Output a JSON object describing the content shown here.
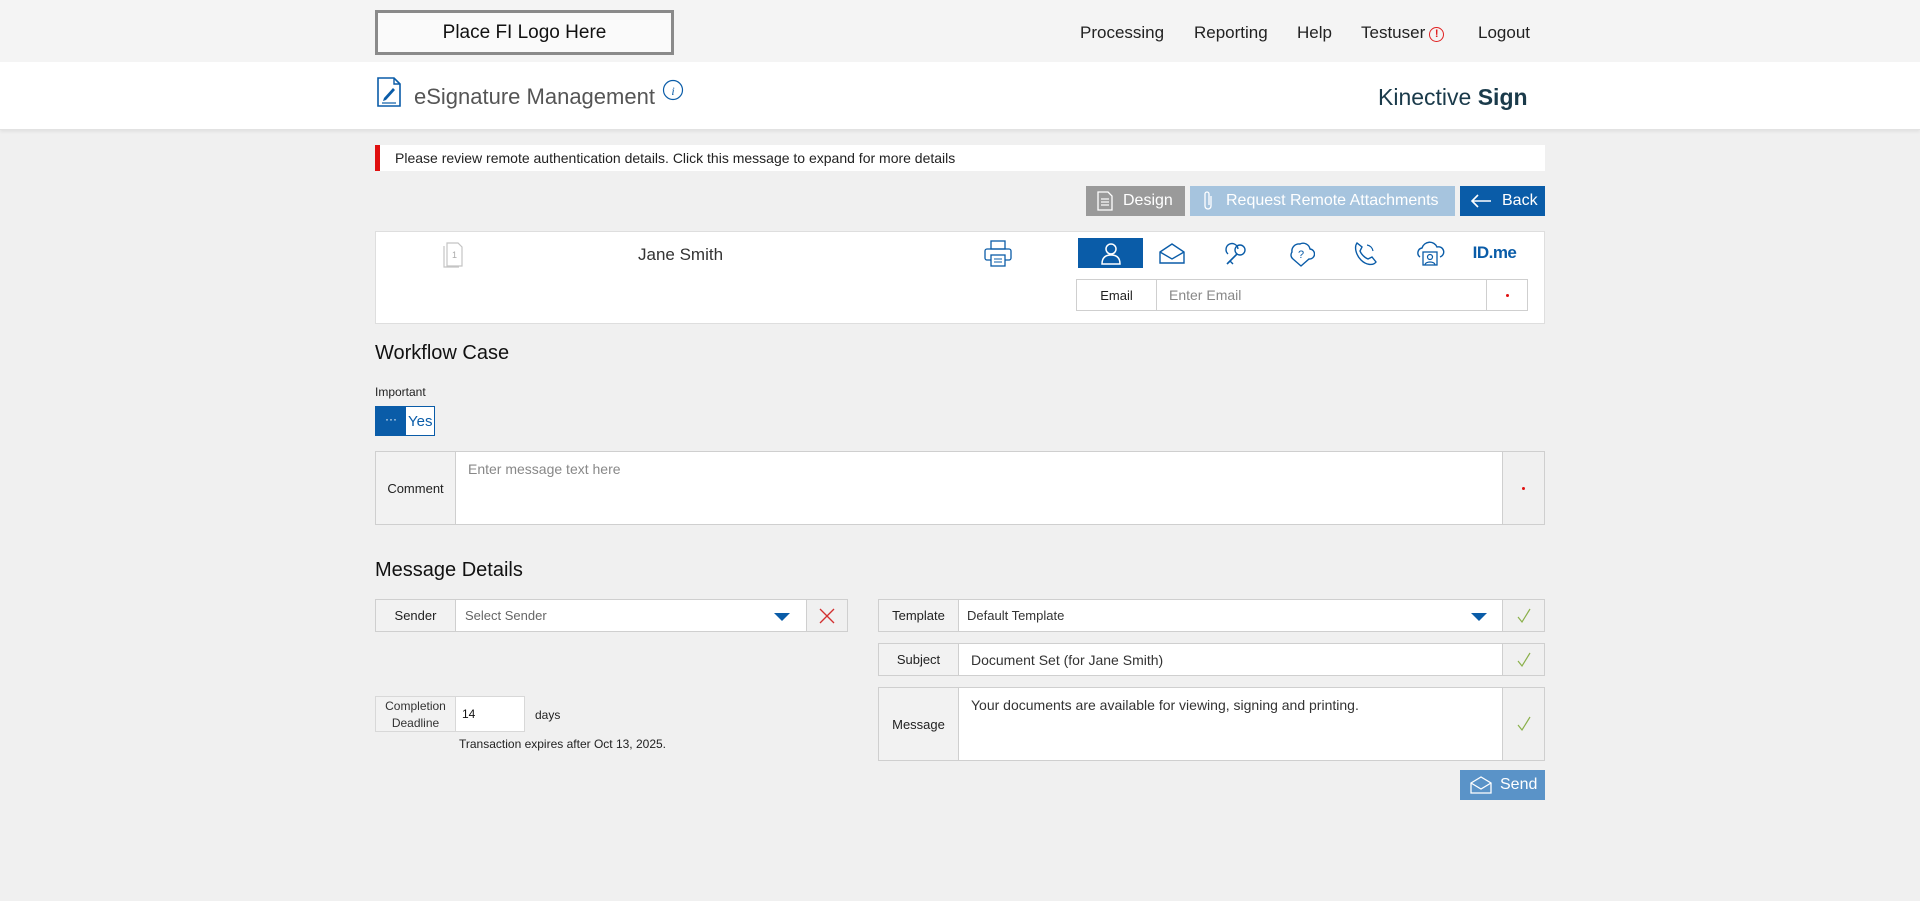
{
  "topnav": {
    "logo_text": "Place FI Logo Here",
    "items": [
      "Processing",
      "Reporting",
      "Help",
      "Testuser",
      "Logout"
    ]
  },
  "header": {
    "title": "eSignature Management",
    "brand_regular": "Kinective ",
    "brand_bold": "Sign"
  },
  "banner": {
    "text": "Please review remote authentication details. Click this message to expand for more details"
  },
  "actions": {
    "design_label": "Design",
    "request_label": "Request Remote Attachments",
    "back_label": "Back",
    "send_label": "Send"
  },
  "signer": {
    "number": "1",
    "name": "Jane Smith",
    "idme_label": "ID.me",
    "auth_methods": [
      "person-icon",
      "email-icon",
      "key-icon",
      "shield-question-icon",
      "phone-icon",
      "cloud-person-icon",
      "idme-icon"
    ],
    "email_label": "Email",
    "email_placeholder": "Enter Email"
  },
  "workflow": {
    "title": "Workflow Case",
    "important_label": "Important",
    "toggle_knob": "···",
    "toggle_value": "Yes",
    "comment_label": "Comment",
    "comment_placeholder": "Enter message text here"
  },
  "message_details": {
    "title": "Message Details",
    "sender_label": "Sender",
    "sender_placeholder": "Select Sender",
    "template_label": "Template",
    "template_value": "Default Template",
    "subject_label": "Subject",
    "subject_value": "Document Set (for Jane Smith)",
    "message_label": "Message",
    "message_value": "Your documents are available for viewing, signing and printing.",
    "deadline_label_1": "Completion",
    "deadline_label_2": "Deadline",
    "deadline_value": "14",
    "deadline_unit": "days",
    "expiry_note": "Transaction expires after Oct 13, 2025."
  },
  "colors": {
    "primary": "#0a5ca8",
    "alert": "#e01010",
    "valid_check": "#8ab04a"
  }
}
